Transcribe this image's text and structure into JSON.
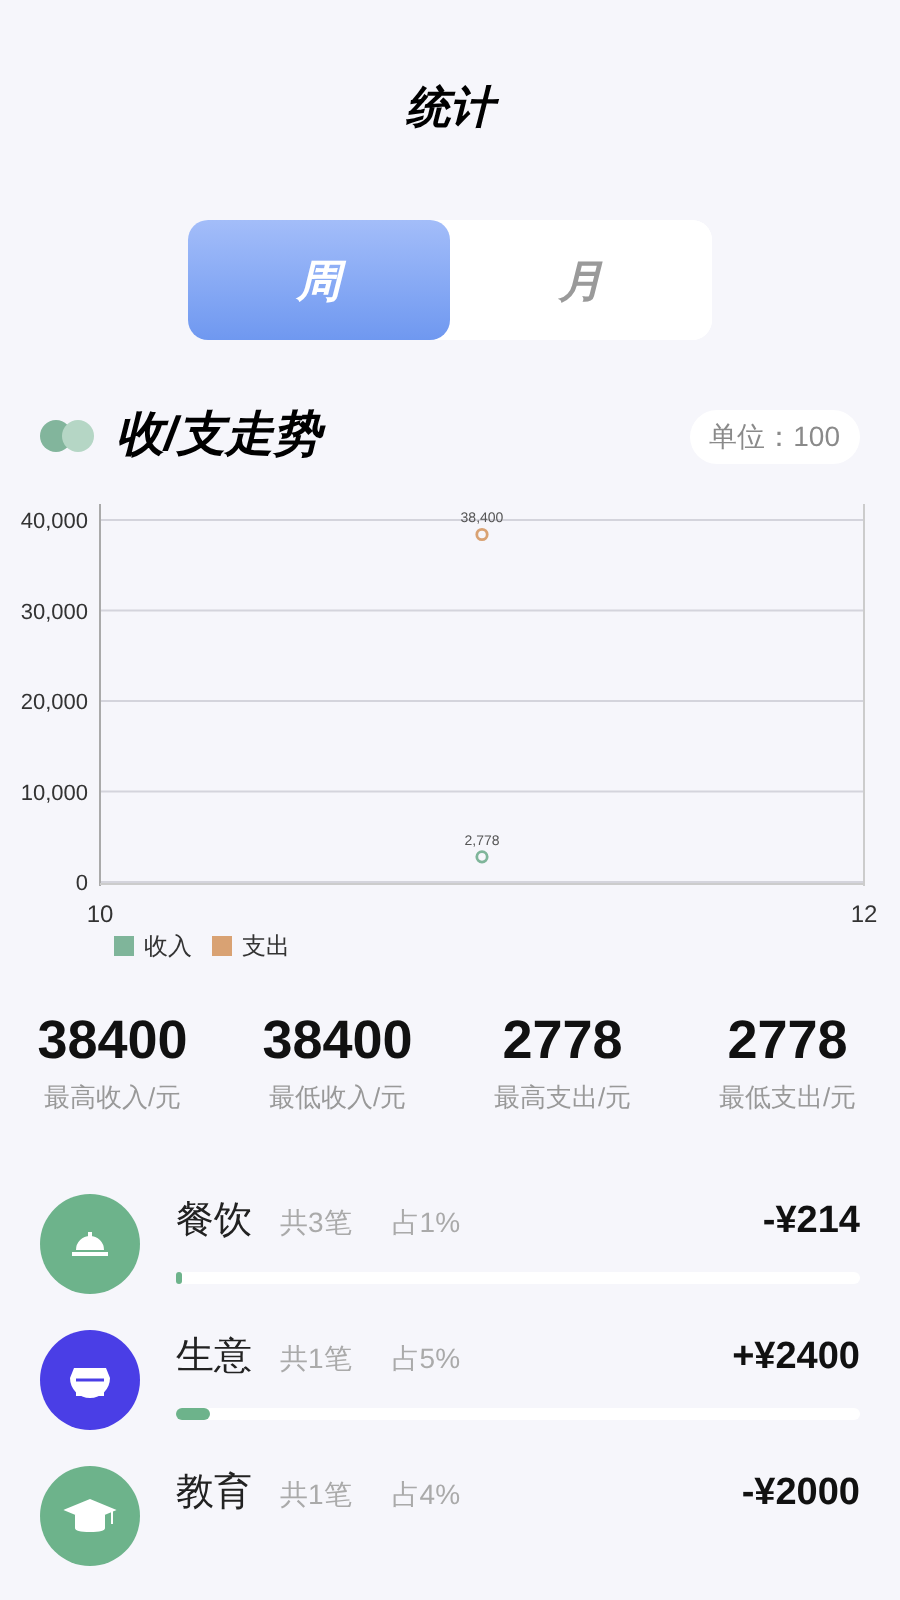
{
  "title": "统计",
  "tabs": [
    {
      "label": "周",
      "selected": true
    },
    {
      "label": "月",
      "selected": false
    }
  ],
  "trend": {
    "heading": "收/支走势",
    "unit": "单位：100",
    "chart_data": {
      "type": "scatter",
      "x": [
        11
      ],
      "xlim": [
        10,
        12
      ],
      "ylim": [
        0,
        40000
      ],
      "xticks": [
        10,
        12
      ],
      "yticks": [
        {
          "value": 0,
          "label": "0"
        },
        {
          "value": 10000,
          "label": "10,000"
        },
        {
          "value": 20000,
          "label": "20,000"
        },
        {
          "value": 30000,
          "label": "30,000"
        },
        {
          "value": 40000,
          "label": "40,000"
        }
      ],
      "data_labels": true,
      "grid": true,
      "series": [
        {
          "name": "收入",
          "color": "#7fb59a",
          "values": [
            2778
          ],
          "value_labels": [
            "2,778"
          ]
        },
        {
          "name": "支出",
          "color": "#d9a273",
          "values": [
            38400
          ],
          "value_labels": [
            "38,400"
          ]
        }
      ]
    }
  },
  "stats": [
    {
      "value": "38400",
      "label": "最高收入/元"
    },
    {
      "value": "38400",
      "label": "最低收入/元"
    },
    {
      "value": "2778",
      "label": "最高支出/元"
    },
    {
      "value": "2778",
      "label": "最低支出/元"
    }
  ],
  "categories": [
    {
      "name": "餐饮",
      "count": "共3笔",
      "share": "占1%",
      "amount": "-¥214",
      "kind": "dining",
      "color": "#6db38b",
      "level": 0.01
    },
    {
      "name": "生意",
      "count": "共1笔",
      "share": "占5%",
      "amount": "+¥2400",
      "kind": "business",
      "color": "#4a3ee6",
      "level": 0.05
    },
    {
      "name": "教育",
      "count": "共1笔",
      "share": "占4%",
      "amount": "-¥2000",
      "kind": "education",
      "color": "#6db38b"
    }
  ]
}
